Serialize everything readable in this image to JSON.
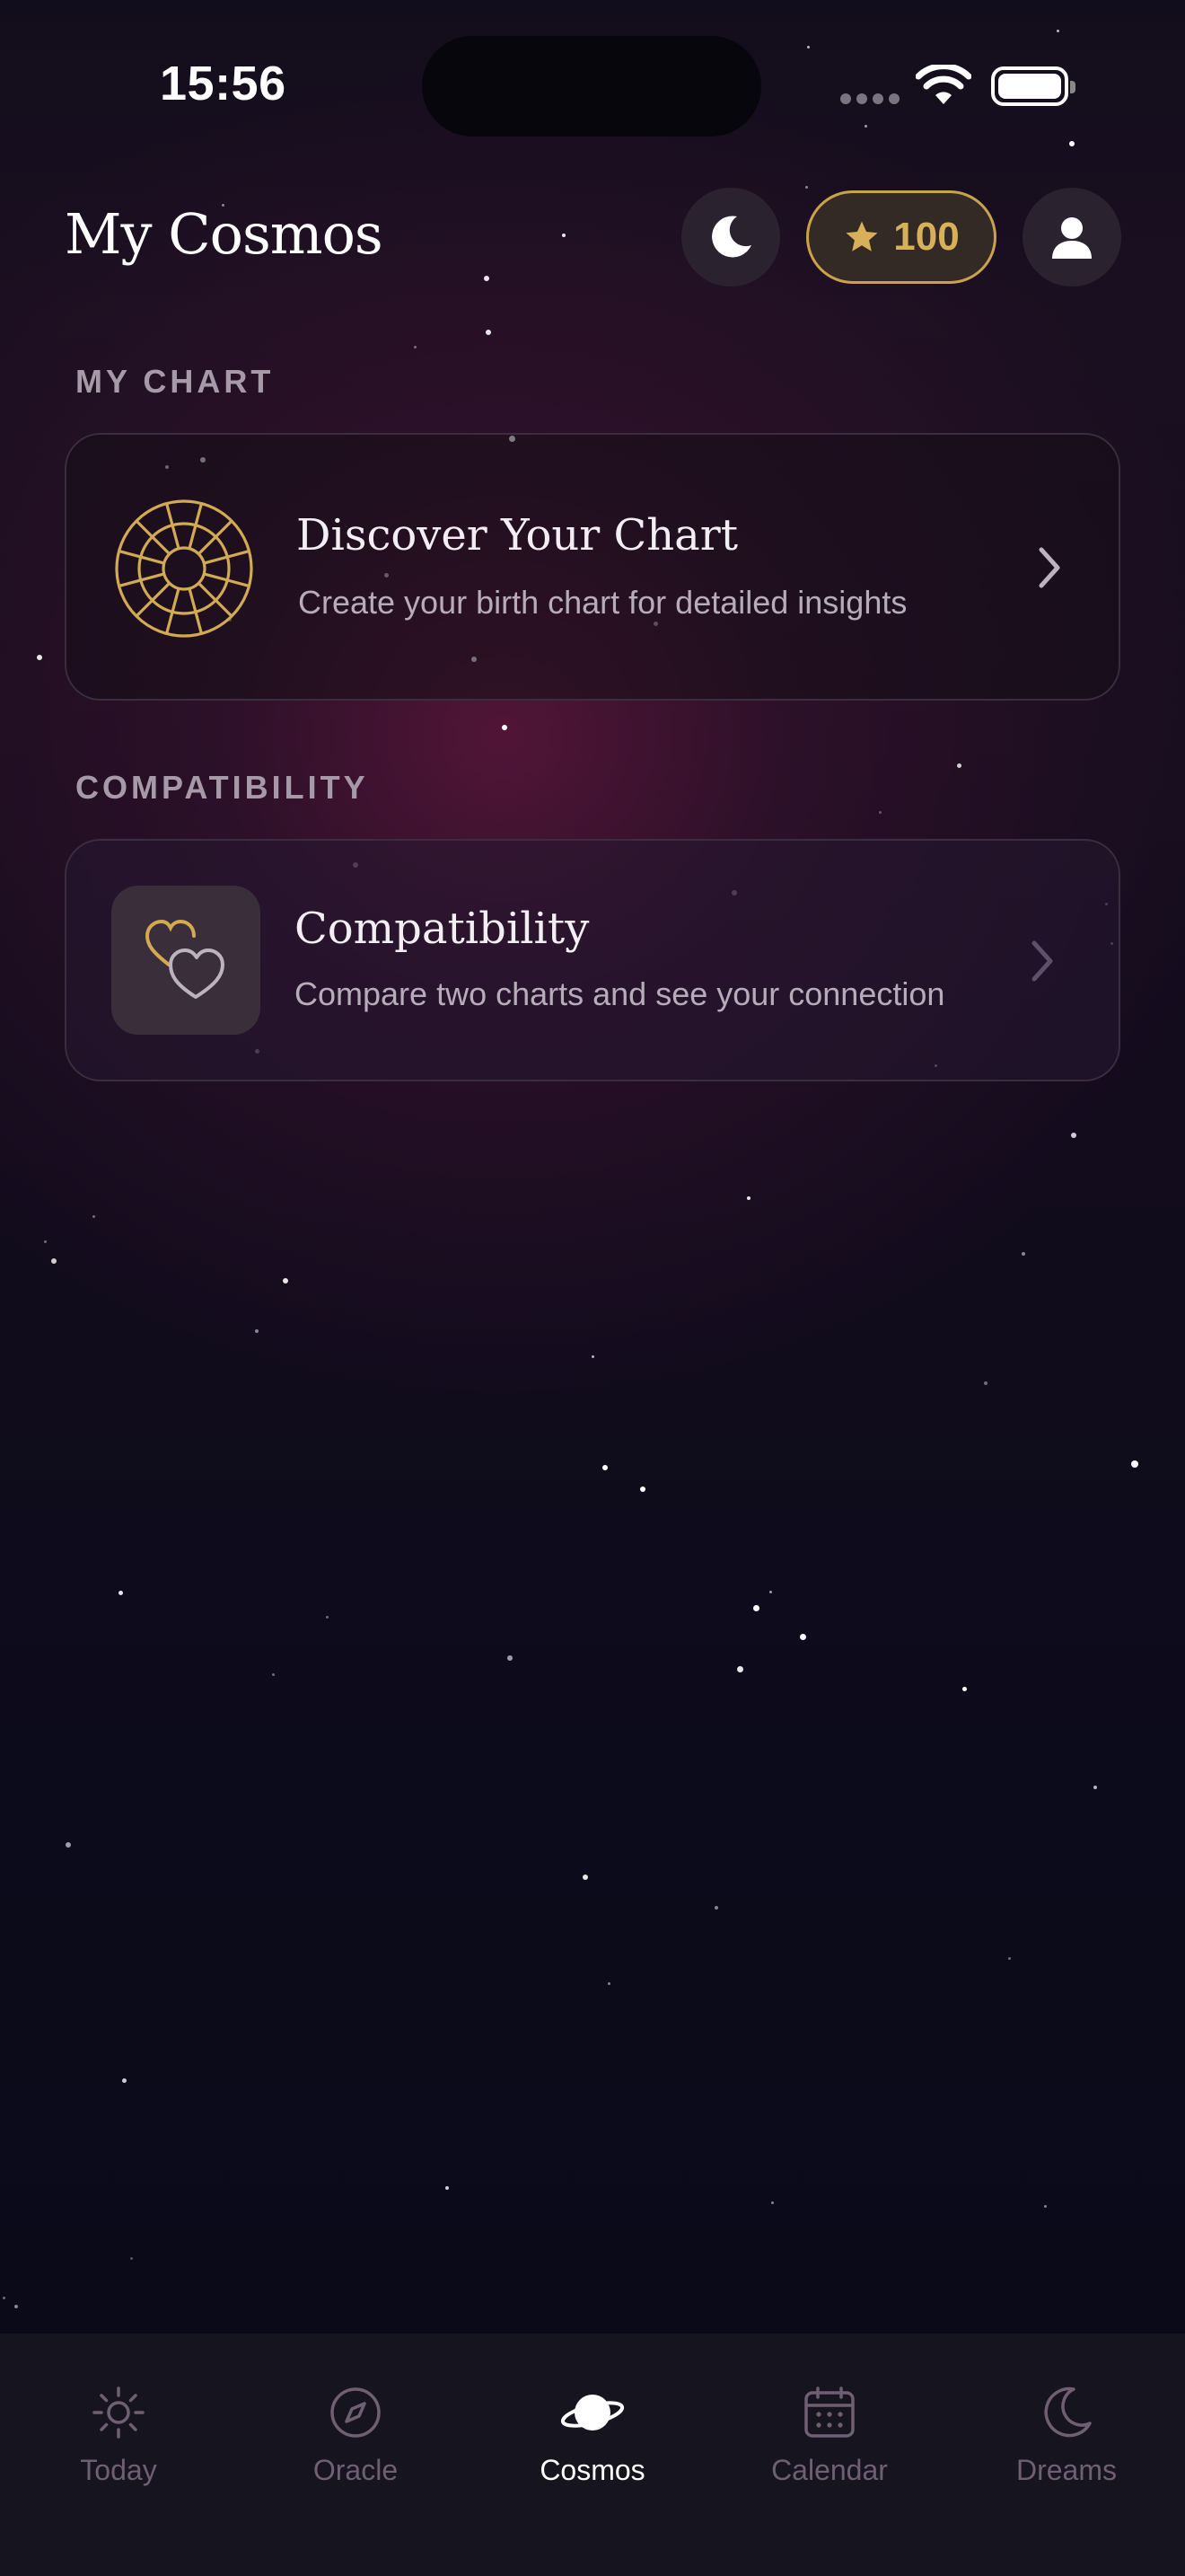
{
  "status_bar": {
    "time": "15:56"
  },
  "header": {
    "title": "My Cosmos",
    "points": "100",
    "icons": {
      "theme": "moon-icon",
      "points": "star-icon",
      "profile": "person-icon"
    }
  },
  "sections": {
    "my_chart": {
      "label": "MY CHART",
      "card": {
        "title": "Discover Your Chart",
        "subtitle": "Create your birth chart for detailed insights",
        "icon": "zodiac-wheel-icon"
      }
    },
    "compatibility": {
      "label": "COMPATIBILITY",
      "card": {
        "title": "Compatibility",
        "subtitle": "Compare two charts and see your connection",
        "icon": "two-hearts-icon"
      }
    }
  },
  "tabbar": {
    "active": "Cosmos",
    "tabs": [
      {
        "label": "Today",
        "icon": "sun-icon"
      },
      {
        "label": "Oracle",
        "icon": "compass-icon"
      },
      {
        "label": "Cosmos",
        "icon": "planet-icon"
      },
      {
        "label": "Calendar",
        "icon": "calendar-icon"
      },
      {
        "label": "Dreams",
        "icon": "moon-icon"
      }
    ]
  },
  "colors": {
    "accent_gold": "#d9b05a",
    "background": "#0b0b1a",
    "active_tab": "#ffffff",
    "inactive_tab": "#6f5f74"
  }
}
